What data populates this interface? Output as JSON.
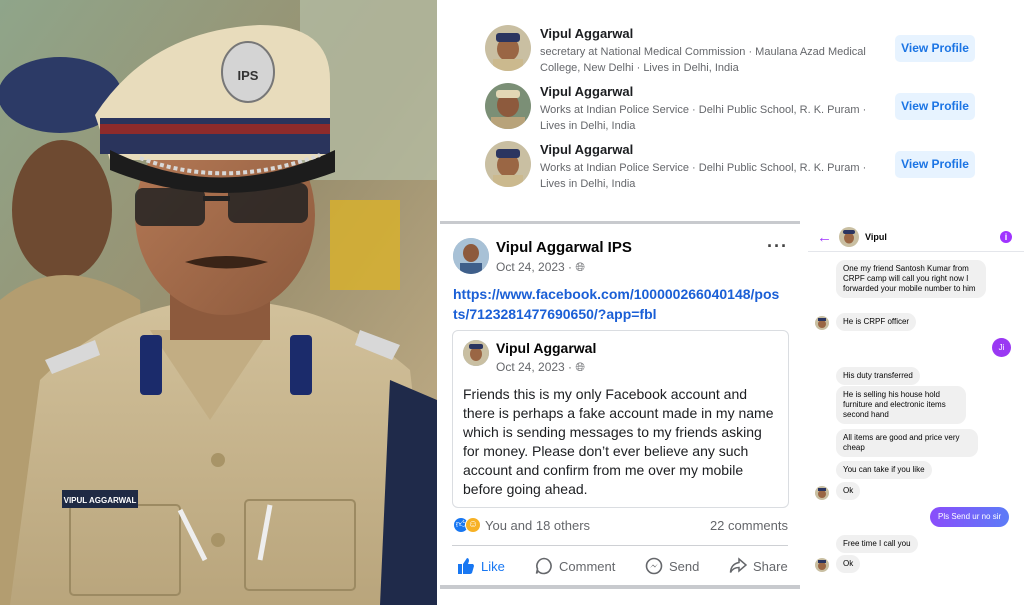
{
  "results": [
    {
      "name": "Vipul Aggarwal",
      "description": "secretary at National Medical Commission · Maulana Azad Medical College, New Delhi · Lives in Delhi, India",
      "button": "View Profile"
    },
    {
      "name": "Vipul Aggarwal",
      "description": "Works at Indian Police Service · Delhi Public School, R. K. Puram · Lives in Delhi, India",
      "button": "View Profile"
    },
    {
      "name": "Vipul Aggarwal",
      "description": "Works at Indian Police Service · Delhi Public School, R. K. Puram · Lives in Delhi, India",
      "button": "View Profile"
    }
  ],
  "post": {
    "author": "Vipul Aggarwal IPS",
    "date": "Oct 24, 2023 ·",
    "more_icon": "···",
    "link": "https://www.facebook.com/100000266040148/posts/7123281477690650/?app=fbl",
    "shared": {
      "author": "Vipul Aggarwal",
      "date": "Oct 24, 2023 ·",
      "body": "Friends this is my only Facebook account and there is perhaps a fake account made in my name which is sending messages to my friends asking for money. Please don’t ever believe any such account and confirm from me over my mobile before going ahead."
    },
    "reactions_text": "You and 18 others",
    "comments_text": "22 comments",
    "actions": {
      "like": "Like",
      "comment": "Comment",
      "send": "Send",
      "share": "Share"
    }
  },
  "chat": {
    "contact": "Vipul",
    "messages": {
      "m1": "One my friend Santosh Kumar from CRPF camp will call you right now I forwarded your mobile number to him",
      "m2": "He is CRPF officer",
      "m3": "Ji",
      "m4": "His duty transferred",
      "m5": "He is selling his house hold furniture and electronic items second hand",
      "m6": "All items are good and price very cheap",
      "m7": "You can take if you like",
      "m8": "Ok",
      "m9": "Pls Send ur no sir",
      "m10": "Free time I call you",
      "m11": "Ok"
    }
  },
  "photo": {
    "cap_badge": "IPS",
    "name_tag": "VIPUL AGGARWAL"
  },
  "colors": {
    "facebook_blue": "#1877f2",
    "view_profile_bg": "#e7f3ff",
    "messenger_purple": "#a033ff",
    "uniform_khaki": "#c7b48a"
  }
}
